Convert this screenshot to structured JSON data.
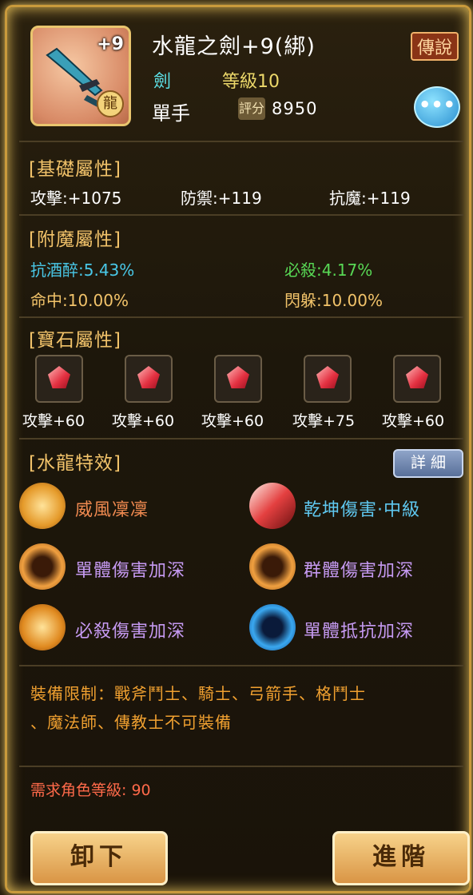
{
  "item": {
    "enhance": "+9",
    "seal_char": "龍",
    "name": "水龍之劍+9(綁)",
    "rarity": "傳說",
    "type": "劍",
    "level": "等級10",
    "hand": "單手",
    "score_label": "評分",
    "score": "8950",
    "more": "•••"
  },
  "base": {
    "title": "[基礎屬性]",
    "atk": "攻擊:+1075",
    "def": "防禦:+119",
    "mres": "抗魔:+119"
  },
  "enchant": {
    "title": "[附魔屬性]",
    "a": "抗酒醉:5.43%",
    "b": "必殺:4.17%",
    "c": "命中:10.00%",
    "d": "閃躲:10.00%"
  },
  "gems": {
    "title": "[寶石屬性]",
    "items": [
      "攻擊+60",
      "攻擊+60",
      "攻擊+60",
      "攻擊+75",
      "攻擊+60"
    ]
  },
  "special": {
    "title": "[水龍特效]",
    "detail": "詳 細",
    "skills": [
      "威風凜凜",
      "乾坤傷害·中級",
      "單體傷害加深",
      "群體傷害加深",
      "必殺傷害加深",
      "單體抵抗加深"
    ]
  },
  "restriction": {
    "line1": "裝備限制：戰斧鬥士、騎士、弓箭手、格鬥士",
    "line2": "、魔法師、傳教士不可裝備"
  },
  "requirement": "需求角色等級: 90",
  "buttons": {
    "unequip": "卸下",
    "upgrade": "進階"
  },
  "colors": {
    "gold": "#f2c36a",
    "cyan": "#49c8e8",
    "green": "#58d855",
    "red": "#ff6a4a"
  }
}
